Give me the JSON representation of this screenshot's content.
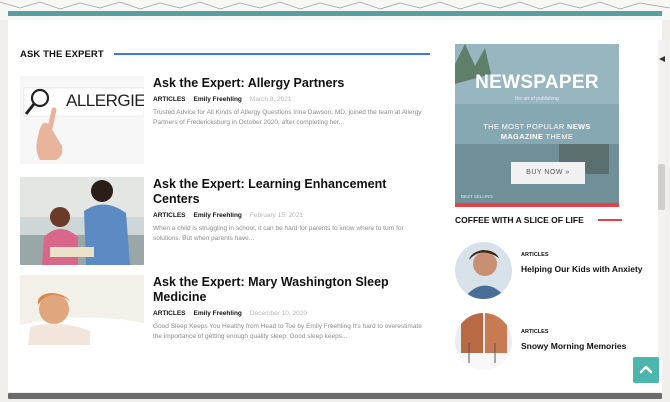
{
  "section": {
    "title": "ASK THE EXPERT"
  },
  "articles": [
    {
      "title": "Ask the Expert: Allergy Partners",
      "category": "ARTICLES",
      "author": "Emily Freehling",
      "date": "March 8, 2021",
      "excerpt": "Trusted Advice for All Kinds of Allergy Questions Irina Dawson, MD, joined the team at Allergy Partners of Fredericksburg in October 2020, after completing her...",
      "thumb_text": "ALLERGIES"
    },
    {
      "title": "Ask the Expert: Learning Enhancement Centers",
      "category": "ARTICLES",
      "author": "Emily Freehling",
      "date": "February 15, 2021",
      "excerpt": "When a child is struggling in school, it can be hard for parents to know where to turn for solutions. But when parents have..."
    },
    {
      "title": "Ask the Expert: Mary Washington Sleep Medicine",
      "category": "ARTICLES",
      "author": "Emily Freehling",
      "date": "December 10, 2020",
      "excerpt": "Good Sleep Keeps You Healthy from Head to Toe by Emily Freehling It's hard to overestimate the importance of getting enough quality sleep. Good sleep keeps..."
    }
  ],
  "ad": {
    "title": "NEWSPAPER",
    "subtitle": "the art of publishing",
    "line1_prefix": "THE MOST POPULAR ",
    "line1_bold": "NEWS",
    "line2_bold": "MAGAZINE",
    "line2_suffix": " THEME",
    "button": "BUY NOW »",
    "corner": "BEST SELLING"
  },
  "sidebar": {
    "title": "COFFEE WITH A SLICE OF LIFE",
    "items": [
      {
        "category": "ARTICLES",
        "title": "Helping Our Kids with Anxiety"
      },
      {
        "category": "ARTICLES",
        "title": "Snowy Morning Memories"
      }
    ]
  },
  "colors": {
    "accent_blue": "#3d7fc8",
    "accent_red": "#e6404b",
    "teal": "#5a9ea0",
    "to_top": "#4db6ac"
  },
  "icons": {
    "scroll_arrow": "arrow-left-icon",
    "to_top": "chevron-up-icon"
  }
}
